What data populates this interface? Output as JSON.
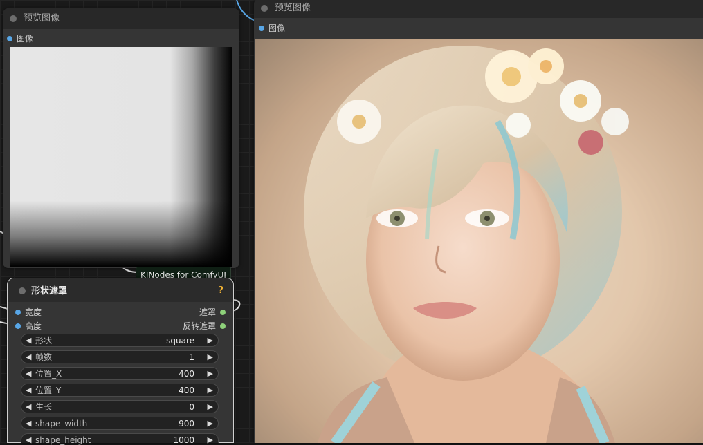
{
  "left_preview_node": {
    "title": "预览图像",
    "input_label": "图像"
  },
  "right_preview_node": {
    "title": "预览图像",
    "input_label": "图像"
  },
  "tooltip": "KJNodes for ComfyUI",
  "shape_mask_node": {
    "title": "形状遮罩",
    "help_icon": "?",
    "inputs": [
      "宽度",
      "高度"
    ],
    "outputs": [
      "遮罩",
      "反转遮罩"
    ],
    "widgets": [
      {
        "name": "形状",
        "value": "square"
      },
      {
        "name": "帧数",
        "value": "1"
      },
      {
        "name": "位置_X",
        "value": "400"
      },
      {
        "name": "位置_Y",
        "value": "400"
      },
      {
        "name": "生长",
        "value": "0"
      },
      {
        "name": "shape_width",
        "value": "900"
      },
      {
        "name": "shape_height",
        "value": "1000"
      }
    ]
  },
  "colors": {
    "link_blue": "#58a6e6",
    "link_green": "#8ed17a",
    "node_bg": "#353535",
    "header_bg": "#282828"
  },
  "icons": [
    "arrow-left-icon",
    "arrow-right-icon",
    "help-icon",
    "status-dot-icon"
  ]
}
